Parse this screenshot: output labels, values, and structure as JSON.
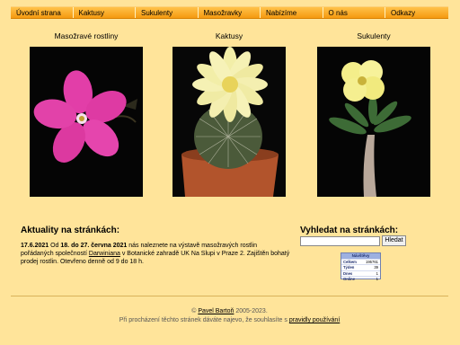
{
  "nav": {
    "items": [
      {
        "label": "Úvodní strana"
      },
      {
        "label": "Kaktusy"
      },
      {
        "label": "Sukulenty"
      },
      {
        "label": "Masožravky"
      },
      {
        "label": "Nabízíme"
      },
      {
        "label": "O nás"
      },
      {
        "label": "Odkazy"
      }
    ]
  },
  "categories": [
    {
      "title": "Masožravé rostliny"
    },
    {
      "title": "Kaktusy"
    },
    {
      "title": "Sukulenty"
    }
  ],
  "news": {
    "title": "Aktuality na stránkách:",
    "date": "17.6.2021",
    "t1": " Od ",
    "from": "18. do 27. června 2021",
    "t2": " nás naleznete na výstavě masožravých rostlin pořádaných společností ",
    "link": "Darwiniana",
    "t3": " v Botanické zahradě UK Na Slupi v Praze 2. Zajištěn bohatý prodej rostlin. Otevřeno denně od 9 do 18 h."
  },
  "search": {
    "title": "Vyhledat na stránkách:",
    "value": "",
    "button_label": "Hledat"
  },
  "stats": {
    "header": "Návštěvy",
    "rows": [
      {
        "label": "Celkem",
        "value": "195761"
      },
      {
        "label": "Týden",
        "value": "39"
      },
      {
        "label": "Dnes",
        "value": "1"
      },
      {
        "label": "Online",
        "value": "1"
      }
    ]
  },
  "footer": {
    "copy_prefix": "© ",
    "author": "Pavel Bartoň",
    "copy_years": " 2005-2023.",
    "consent_text": "Při procházení těchto stránek dáváte najevo, že souhlasíte s ",
    "consent_link": "pravidly používání"
  },
  "colors": {
    "page_background": "#ffe49a",
    "nav_gradient_top": "#ffc24a",
    "nav_gradient_bottom": "#f59a10"
  }
}
